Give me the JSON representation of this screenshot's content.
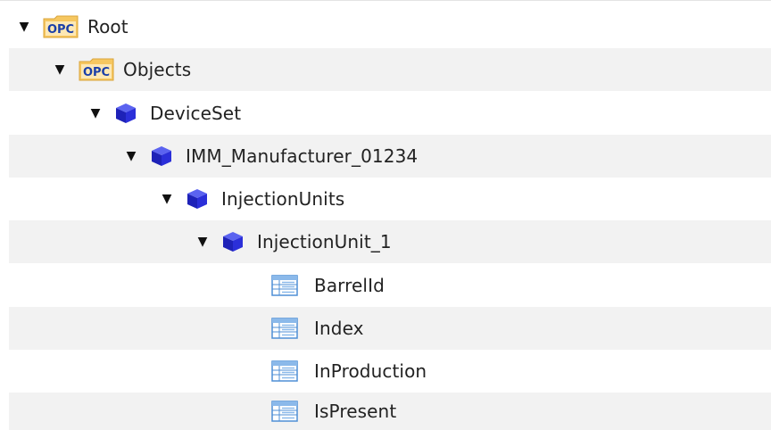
{
  "tree": {
    "nodes": [
      {
        "label": "Root",
        "icon": "opc-folder-icon",
        "expanded": true
      },
      {
        "label": "Objects",
        "icon": "opc-folder-icon",
        "expanded": true
      },
      {
        "label": "DeviceSet",
        "icon": "object-cube-icon",
        "expanded": true
      },
      {
        "label": "IMM_Manufacturer_01234",
        "icon": "object-cube-icon",
        "expanded": true
      },
      {
        "label": "InjectionUnits",
        "icon": "object-cube-icon",
        "expanded": true
      },
      {
        "label": "InjectionUnit_1",
        "icon": "object-cube-icon",
        "expanded": true
      },
      {
        "label": "BarrelId",
        "icon": "variable-table-icon"
      },
      {
        "label": "Index",
        "icon": "variable-table-icon"
      },
      {
        "label": "InProduction",
        "icon": "variable-table-icon"
      },
      {
        "label": "IsPresent",
        "icon": "variable-table-icon"
      }
    ],
    "toggle_glyph": "▼",
    "opc_icon_text": "OPC"
  },
  "colors": {
    "alt_row": "#f2f2f2",
    "cube": "#2b2fd9",
    "opc_folder": "#f6c760",
    "variable_icon": "#4f8fd6"
  }
}
